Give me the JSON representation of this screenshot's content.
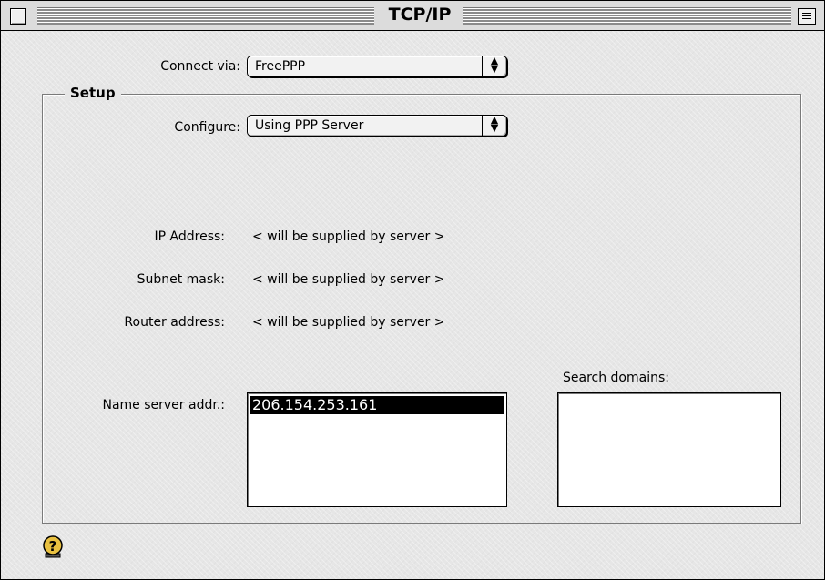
{
  "window": {
    "title": "TCP/IP"
  },
  "connect_via": {
    "label": "Connect via:",
    "value": "FreePPP"
  },
  "setup": {
    "title": "Setup",
    "configure": {
      "label": "Configure:",
      "value": "Using PPP Server"
    },
    "ip_address": {
      "label": "IP Address:",
      "value": "< will be supplied by server >"
    },
    "subnet_mask": {
      "label": "Subnet mask:",
      "value": "< will be supplied by server >"
    },
    "router_address": {
      "label": "Router address:",
      "value": "< will be supplied by server >"
    },
    "name_server": {
      "label": "Name server addr.:",
      "entries": [
        "206.154.253.161"
      ]
    },
    "search_domains": {
      "label": "Search domains:",
      "entries": []
    }
  },
  "icons": {
    "help": "help-question-icon",
    "close": "close-box-icon",
    "collapse": "collapse-box-icon",
    "popup_arrows": "updown-arrows-icon"
  }
}
